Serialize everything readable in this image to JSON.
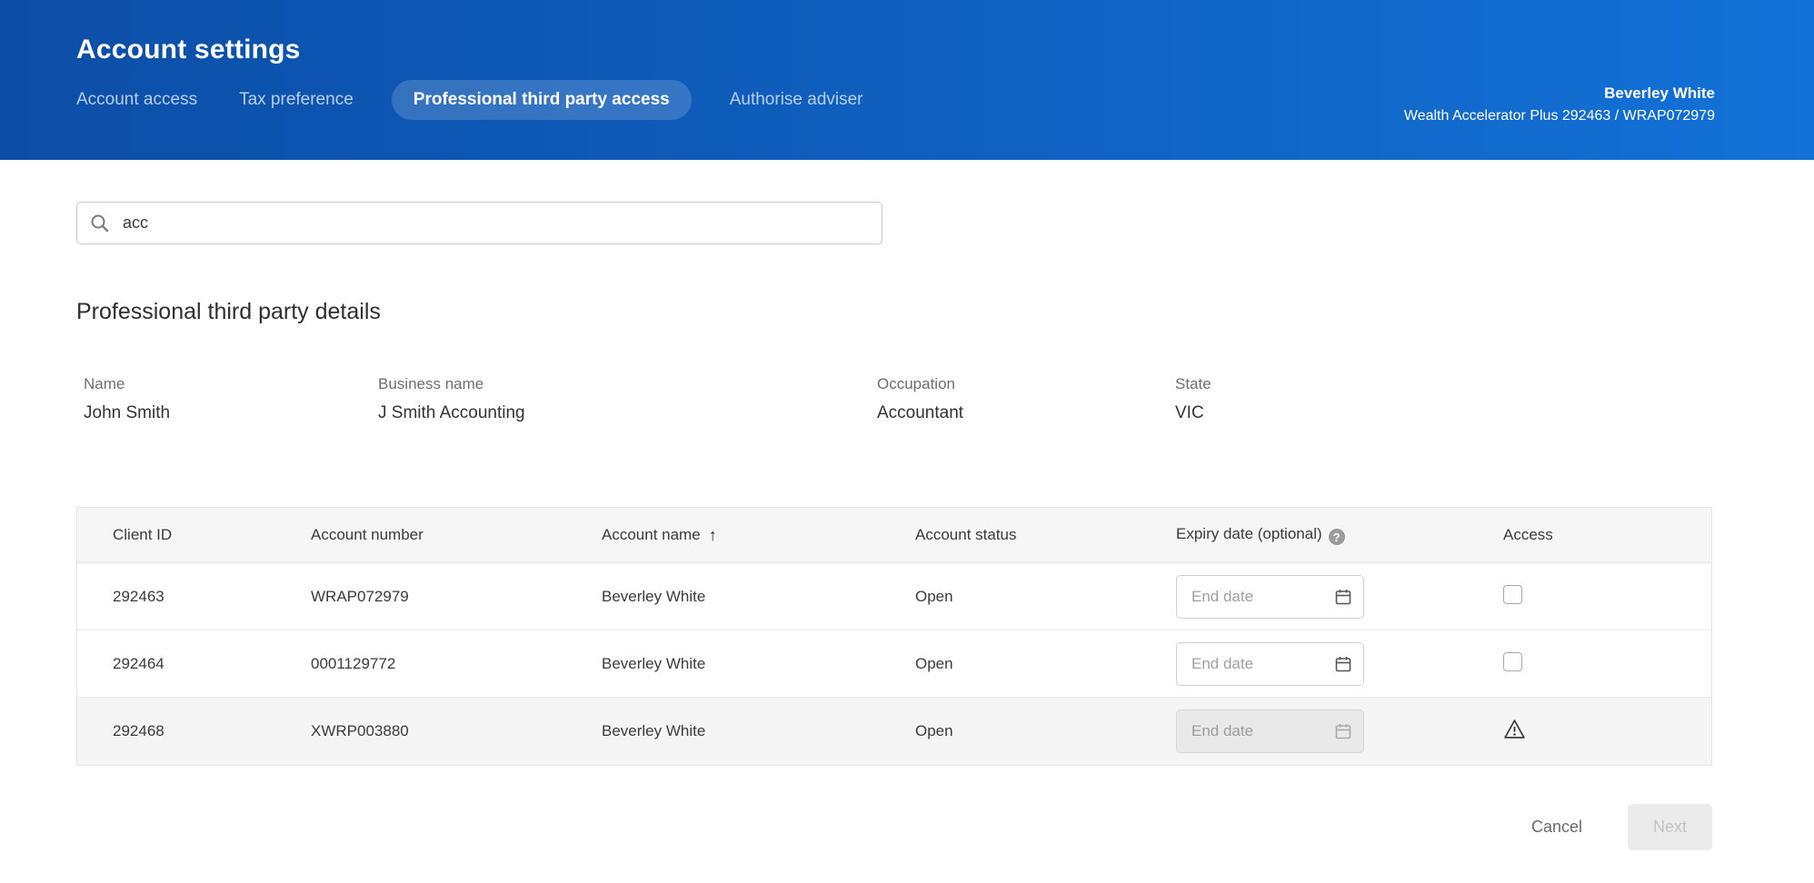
{
  "header": {
    "title": "Account settings",
    "tabs": [
      {
        "label": "Account access"
      },
      {
        "label": "Tax preference"
      },
      {
        "label": "Professional third party access"
      },
      {
        "label": "Authorise adviser"
      }
    ],
    "active_tab": "Professional third party access",
    "user_name": "Beverley White",
    "user_account": "Wealth Accelerator Plus 292463 / WRAP072979"
  },
  "search": {
    "value": "acc"
  },
  "section": {
    "heading": "Professional third party details"
  },
  "details": [
    {
      "label": "Name",
      "value": "John Smith"
    },
    {
      "label": "Business name",
      "value": "J Smith Accounting"
    },
    {
      "label": "Occupation",
      "value": "Accountant"
    },
    {
      "label": "State",
      "value": "VIC"
    }
  ],
  "table": {
    "columns": {
      "client_id": "Client ID",
      "account_number": "Account number",
      "account_name": "Account name",
      "account_status": "Account status",
      "expiry_date": "Expiry date (optional)",
      "access": "Access"
    },
    "sort_column": "Account name",
    "sort_direction": "ascending",
    "rows": [
      {
        "client_id": "292463",
        "account_number": "WRAP072979",
        "account_name": "Beverley White",
        "status": "Open",
        "expiry_placeholder": "End date",
        "access_state": "checkbox-unchecked",
        "disabled": false
      },
      {
        "client_id": "292464",
        "account_number": "0001129772",
        "account_name": "Beverley White",
        "status": "Open",
        "expiry_placeholder": "End date",
        "access_state": "checkbox-unchecked",
        "disabled": false
      },
      {
        "client_id": "292468",
        "account_number": "XWRP003880",
        "account_name": "Beverley White",
        "status": "Open",
        "expiry_placeholder": "End date",
        "access_state": "warning",
        "disabled": true
      }
    ]
  },
  "footer": {
    "cancel_label": "Cancel",
    "next_label": "Next"
  },
  "icons": {
    "sort_ascending": "↑",
    "help": "?"
  },
  "colors": {
    "header_gradient_start": "#0b4ea7",
    "header_gradient_end": "#1371d7",
    "table_header_bg": "#f6f6f6",
    "disabled_row_bg": "#f5f5f5"
  }
}
